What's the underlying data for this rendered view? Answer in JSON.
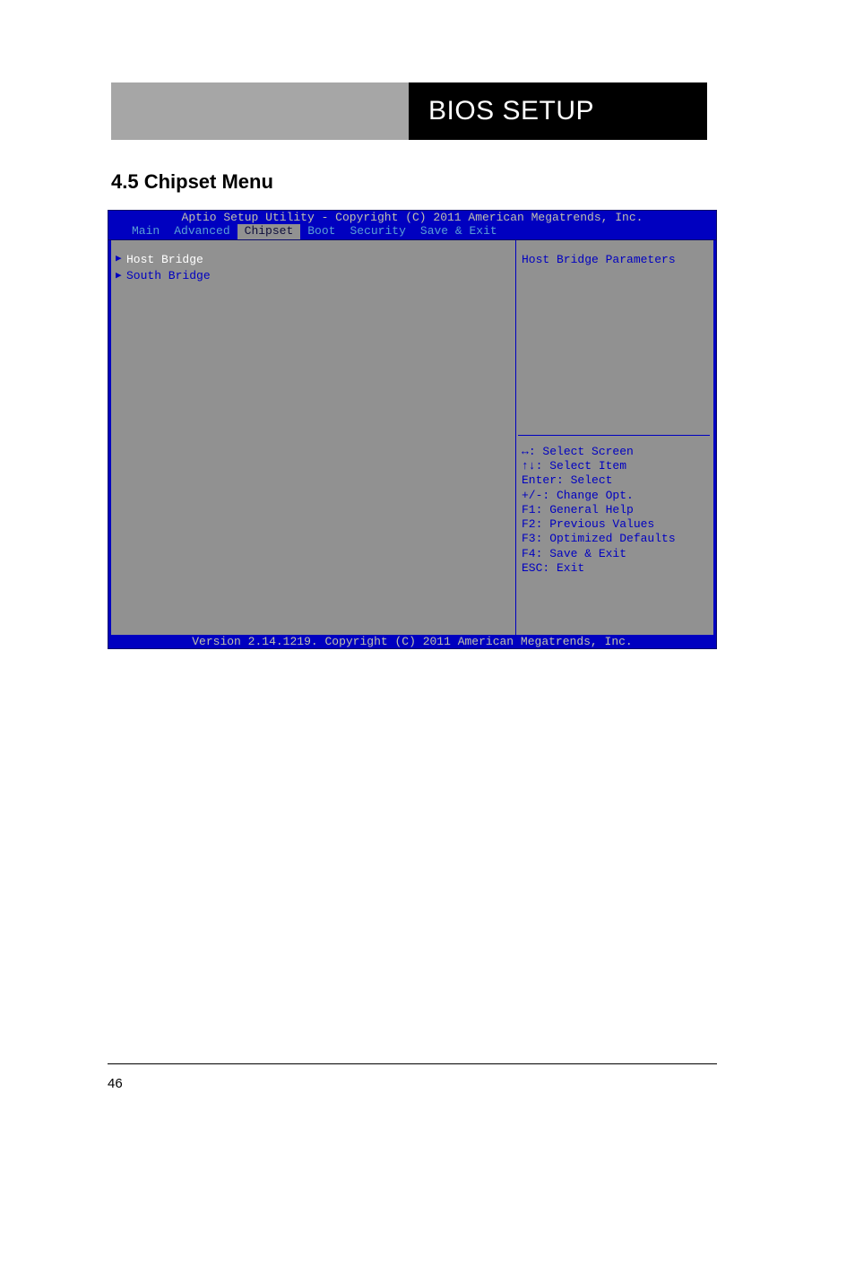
{
  "top_header": {
    "black_label": "BIOS SETUP"
  },
  "section_heading": "4.5 Chipset Menu",
  "bios": {
    "title": "Aptio Setup Utility - Copyright (C) 2011 American Megatrends, Inc.",
    "tabs": [
      "Main",
      "Advanced",
      "Chipset",
      "Boot",
      "Security",
      "Save & Exit"
    ],
    "tabs_active_index": 2,
    "menu_items": [
      {
        "label": "Host Bridge",
        "selected": true
      },
      {
        "label": "South Bridge",
        "selected": false
      }
    ],
    "help_text": "Host Bridge Parameters",
    "nav_hints": [
      {
        "sym": "↔",
        "text": ": Select Screen"
      },
      {
        "sym": "↑↓",
        "text": ": Select Item"
      },
      {
        "sym": "Enter",
        "text": ": Select"
      },
      {
        "sym": "+/-",
        "text": ": Change Opt."
      },
      {
        "sym": "F1",
        "text": ": General Help"
      },
      {
        "sym": "F2",
        "text": ": Previous Values"
      },
      {
        "sym": "F3",
        "text": ": Optimized Defaults"
      },
      {
        "sym": "F4",
        "text": ": Save & Exit"
      },
      {
        "sym": "ESC",
        "text": ": Exit"
      }
    ],
    "footer": "Version 2.14.1219. Copyright (C) 2011 American Megatrends, Inc."
  },
  "page_number": "46"
}
